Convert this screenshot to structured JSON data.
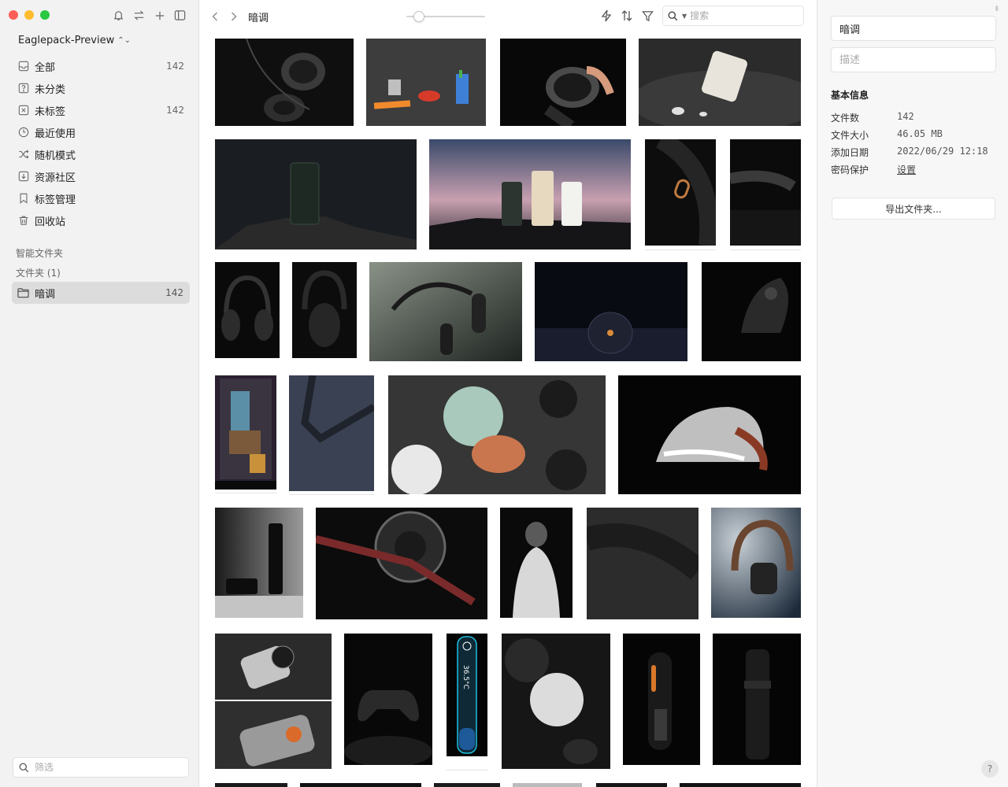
{
  "sidebar": {
    "library_name": "Eaglepack-Preview",
    "items": [
      {
        "label": "全部",
        "count": "142",
        "icon": "inbox-icon"
      },
      {
        "label": "未分类",
        "count": "",
        "icon": "question-box-icon"
      },
      {
        "label": "未标签",
        "count": "142",
        "icon": "tag-off-icon"
      },
      {
        "label": "最近使用",
        "count": "",
        "icon": "clock-icon"
      },
      {
        "label": "随机模式",
        "count": "",
        "icon": "shuffle-icon"
      },
      {
        "label": "资源社区",
        "count": "",
        "icon": "download-box-icon"
      },
      {
        "label": "标签管理",
        "count": "",
        "icon": "bookmark-icon"
      },
      {
        "label": "回收站",
        "count": "",
        "icon": "trash-icon"
      }
    ],
    "smart_folders_label": "智能文件夹",
    "folders_label": "文件夹 (1)",
    "active_folder": {
      "label": "暗调",
      "count": "142"
    },
    "filter_placeholder": "筛选"
  },
  "toolbar": {
    "breadcrumb": "暗调",
    "zoom_level": 0.1,
    "search_placeholder": "搜索"
  },
  "inspector": {
    "name_value": "暗调",
    "description_placeholder": "描述",
    "section_title": "基本信息",
    "rows": [
      {
        "key": "文件数",
        "value": "142"
      },
      {
        "key": "文件大小",
        "value": "46.05 MB"
      },
      {
        "key": "添加日期",
        "value": "2022/06/29 12:18"
      },
      {
        "key": "密码保护",
        "value": "设置"
      }
    ],
    "export_label": "导出文件夹...",
    "help_label": "?"
  },
  "colors": {
    "sidebar_bg": "#f2f2f2",
    "selected_bg": "#dcdcdc",
    "inspector_bg": "#f7f7f7",
    "traffic_red": "#ff5f57",
    "traffic_yellow": "#febc2e",
    "traffic_green": "#28c840"
  }
}
